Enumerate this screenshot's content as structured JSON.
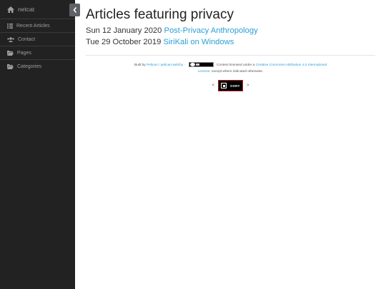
{
  "sidebar": {
    "brand": {
      "label": "netcat",
      "icon": "home-icon"
    },
    "items": [
      {
        "label": "Recent Articles",
        "icon": "list-icon"
      },
      {
        "label": "Contact",
        "icon": "users-icon"
      },
      {
        "label": "Pages",
        "icon": "folder-open-icon"
      },
      {
        "label": "Categories",
        "icon": "folder-open-icon"
      }
    ],
    "toggle_icon": "chevron-left-icon"
  },
  "main": {
    "title": "Articles featuring privacy",
    "articles": [
      {
        "date": "Sun 12 January 2020",
        "title": "Post-Privacy Anthropology"
      },
      {
        "date": "Tue 29 October 2019",
        "title": "SiriKali on Windows"
      }
    ]
  },
  "footer": {
    "built_by_prefix": "Built by",
    "built_by_link": "Pelican / pelican-twitchy",
    "license_prefix": "Content licensed under a",
    "license_link_part1": "Creative Commons Attribution 4.0 International",
    "license_link_part2": "License",
    "license_suffix": ", except where indicated otherwise.",
    "license_badge_icon": "cc-by-badge-icon"
  },
  "webring": {
    "prev": "<",
    "next": ">",
    "badge_label": "OSRY"
  },
  "colors": {
    "sidebar_bg": "#222222",
    "link": "#2a9fd6",
    "toggle_bg": "#5f6368"
  }
}
